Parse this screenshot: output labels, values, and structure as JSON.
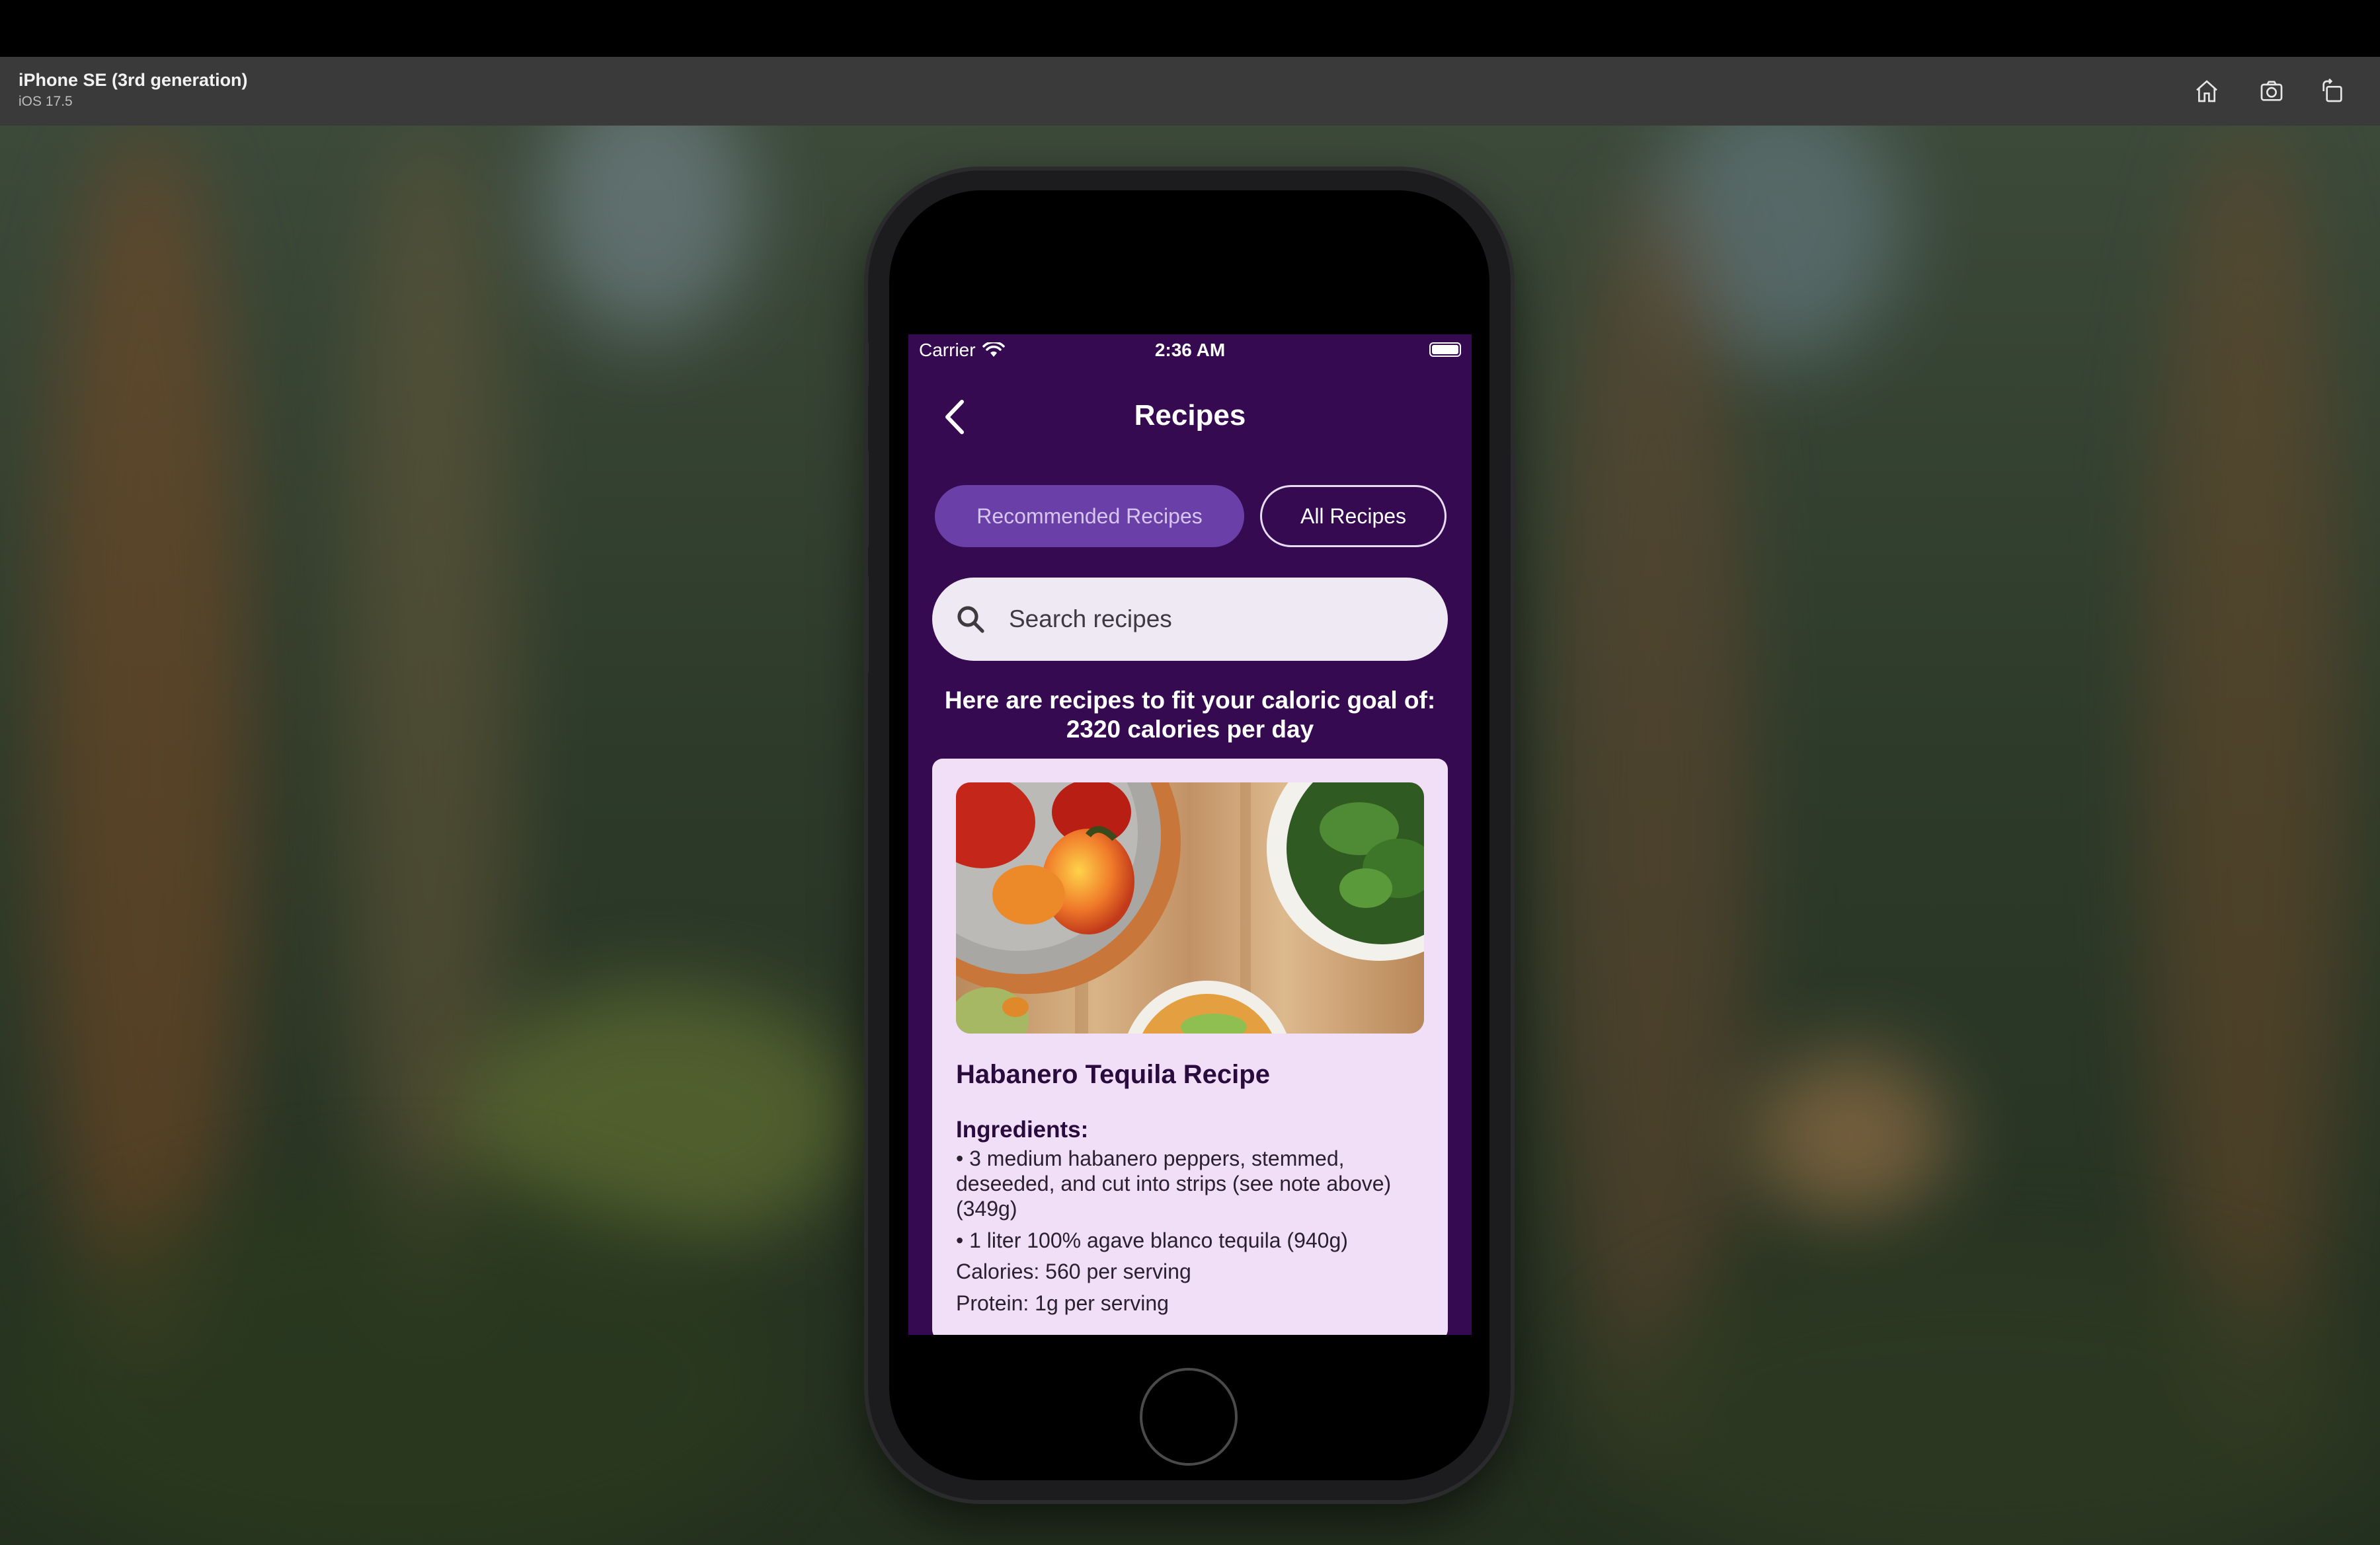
{
  "simulator": {
    "device_name": "iPhone SE (3rd generation)",
    "os_version": "iOS 17.5",
    "buttons": [
      "home-icon",
      "screenshot-icon",
      "rotate-icon"
    ]
  },
  "status_bar": {
    "carrier": "Carrier",
    "time": "2:36 AM"
  },
  "nav": {
    "title": "Recipes",
    "back_icon": "chevron-left-icon"
  },
  "segments": {
    "recommended": "Recommended Recipes",
    "all": "All Recipes",
    "selected": "Recommended Recipes"
  },
  "search": {
    "placeholder": "Search recipes"
  },
  "goal": {
    "line1": "Here are recipes to fit your caloric goal of:",
    "line2": "2320 calories per day"
  },
  "recipe": {
    "title": "Habanero Tequila Recipe",
    "ingredients_heading": "Ingredients:",
    "ingredients": [
      "• 3 medium habanero peppers, stemmed, deseeded, and cut into strips (see note above) (349g)",
      "• 1 liter 100% agave blanco tequila (940g)"
    ],
    "calories": "Calories: 560 per serving",
    "protein": "Protein: 1g per serving"
  },
  "colors": {
    "screen_bg": "#350a50",
    "segment_selected": "#6a40a8",
    "card_bg": "#f1def7"
  }
}
